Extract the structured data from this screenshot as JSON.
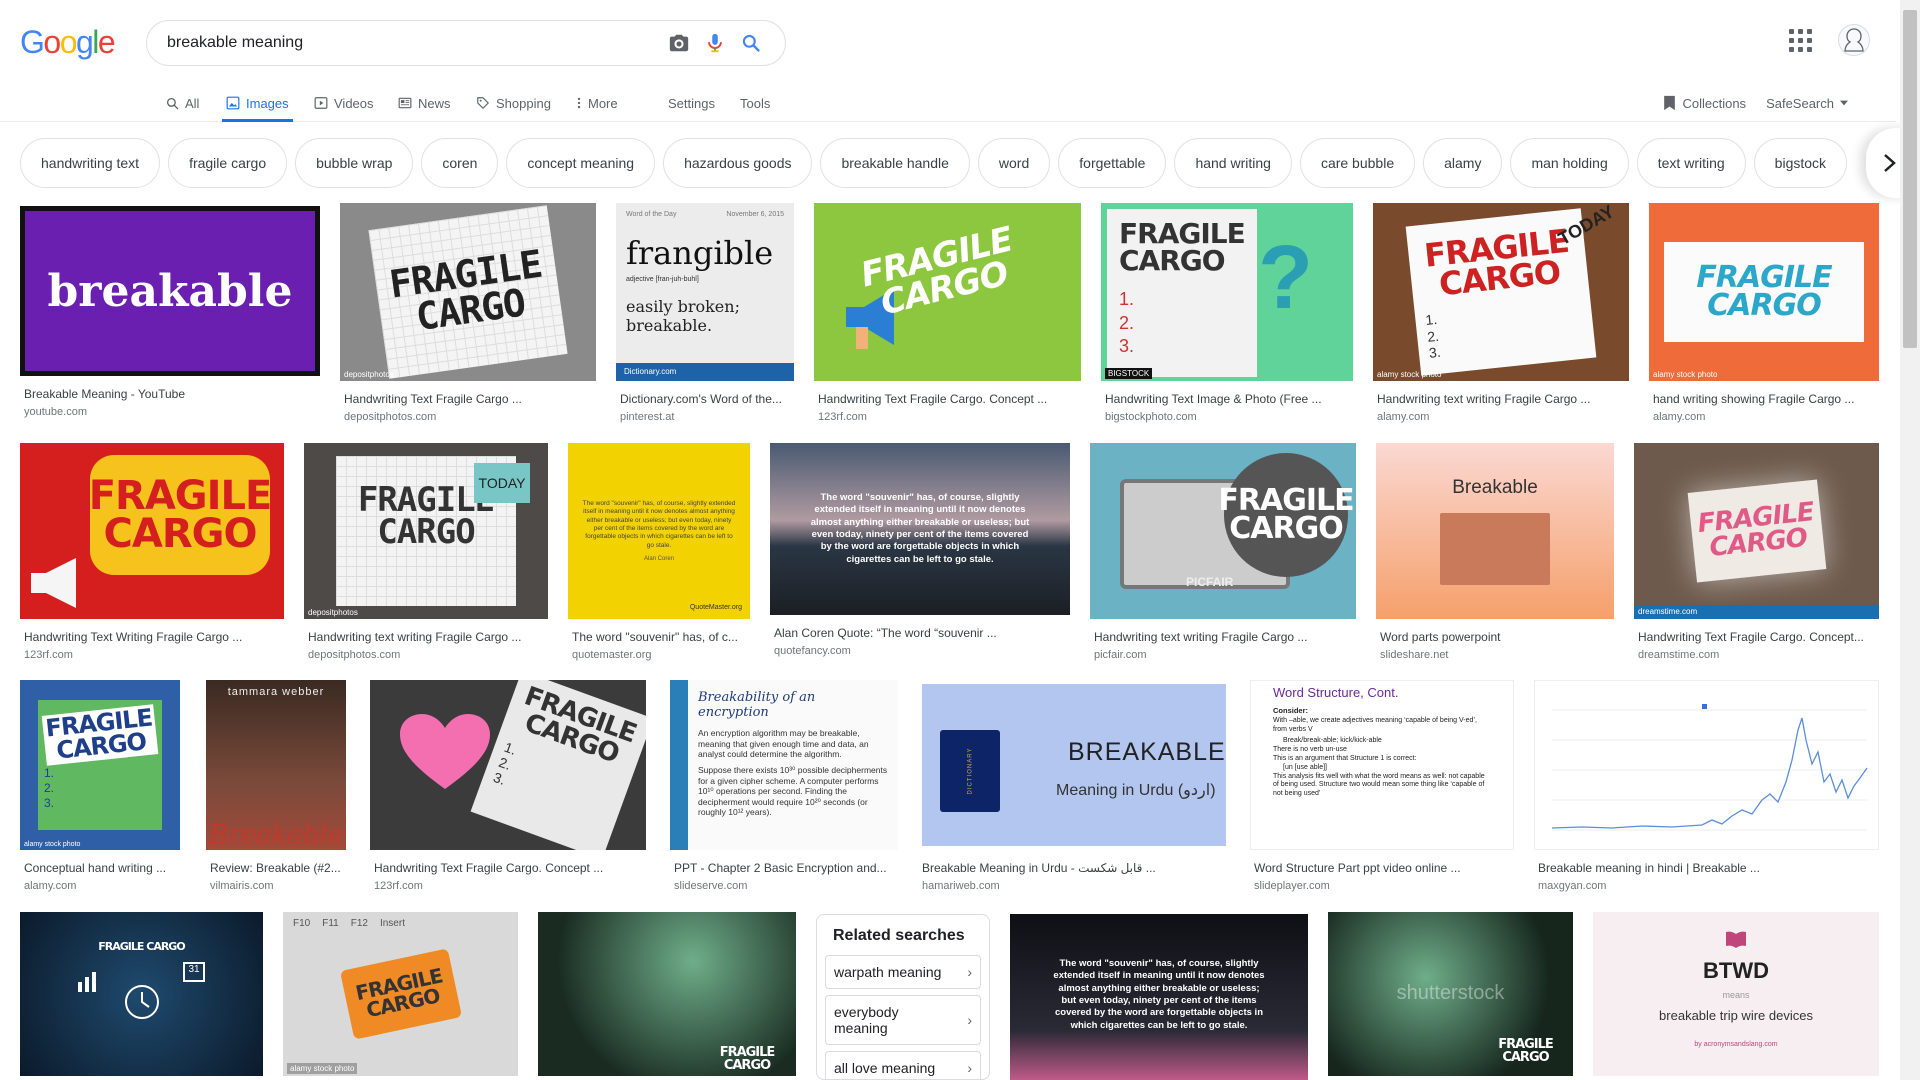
{
  "search": {
    "query": "breakable meaning"
  },
  "logo": {
    "letters": [
      "G",
      "o",
      "o",
      "g",
      "l",
      "e"
    ],
    "colors": [
      "#4285F4",
      "#EA4335",
      "#FBBC05",
      "#4285F4",
      "#34A853",
      "#EA4335"
    ]
  },
  "tabs": [
    {
      "label": "All",
      "icon": "search-icon",
      "active": false
    },
    {
      "label": "Images",
      "icon": "image-icon",
      "active": true
    },
    {
      "label": "Videos",
      "icon": "video-icon",
      "active": false
    },
    {
      "label": "News",
      "icon": "news-icon",
      "active": false
    },
    {
      "label": "Shopping",
      "icon": "tag-icon",
      "active": false
    },
    {
      "label": "More",
      "icon": "more-vert-icon",
      "active": false
    },
    {
      "label": "Settings",
      "active": false
    },
    {
      "label": "Tools",
      "active": false
    }
  ],
  "nav_right": {
    "collections": "Collections",
    "safesearch": "SafeSearch"
  },
  "chips": [
    "handwriting text",
    "fragile cargo",
    "bubble wrap",
    "coren",
    "concept meaning",
    "hazardous goods",
    "breakable handle",
    "word",
    "forgettable",
    "hand writing",
    "care bubble",
    "alamy",
    "man holding",
    "text writing",
    "bigstock"
  ],
  "results": [
    {
      "caption": "Breakable Meaning - YouTube",
      "source": "youtube.com",
      "art": "breakable"
    },
    {
      "caption": "Handwriting Text Fragile Cargo ...",
      "source": "depositphotos.com",
      "art": "FRAGILE CARGO"
    },
    {
      "caption": "Dictionary.com's Word of the...",
      "source": "pinterest.at",
      "art": "frangible"
    },
    {
      "caption": "Handwriting Text Fragile Cargo. Concept ...",
      "source": "123rf.com",
      "art": "FRAGILE CARGO"
    },
    {
      "caption": "Handwriting Text Image & Photo (Free ...",
      "source": "bigstockphoto.com",
      "art": "FRAGILE CARGO"
    },
    {
      "caption": "Handwriting text writing Fragile Cargo ...",
      "source": "alamy.com",
      "art": "FRAGILE CARGO"
    },
    {
      "caption": "hand writing showing Fragile Cargo ...",
      "source": "alamy.com",
      "art": "FRAGILE CARGO"
    },
    {
      "caption": "Handwriting Text Writing Fragile Cargo ...",
      "source": "123rf.com",
      "art": "FRAGILE CARGO"
    },
    {
      "caption": "Handwriting text writing Fragile Cargo ...",
      "source": "depositphotos.com",
      "art": "FRAGILE CARGO"
    },
    {
      "caption": "The word \"souvenir\" has, of c...",
      "source": "quotemaster.org",
      "art": ""
    },
    {
      "caption": "Alan Coren Quote: “The word “souvenir ...",
      "source": "quotefancy.com",
      "art": "The word \"souvenir\" has, of course, slightly extended itself in meaning until it now denotes almost anything either breakable or useless; but even today, ninety per cent of the items covered by the word are forgettable objects in which cigarettes can be left to go stale."
    },
    {
      "caption": "Handwriting text writing Fragile Cargo ...",
      "source": "picfair.com",
      "art": "FRAGILE CARGO"
    },
    {
      "caption": "Word parts powerpoint",
      "source": "slideshare.net",
      "art": "Breakable"
    },
    {
      "caption": "Handwriting Text Fragile Cargo. Concept...",
      "source": "dreamstime.com",
      "art": "FRAGILE CARGO"
    },
    {
      "caption": "Conceptual hand writing ...",
      "source": "alamy.com",
      "art": "FRAGILE CARGO"
    },
    {
      "caption": "Review: Breakable (#2...",
      "source": "vilmairis.com",
      "art": "tammara webber"
    },
    {
      "caption": "Handwriting Text Fragile Cargo. Concept ...",
      "source": "123rf.com",
      "art": "FRAGILE CARGO"
    },
    {
      "caption": "PPT - Chapter 2 Basic Encryption and...",
      "source": "slideserve.com",
      "art": "Breakability of an encryption"
    },
    {
      "caption": "Breakable Meaning in Urdu - قابل شکست ...",
      "source": "hamariweb.com",
      "art": "BREAKABLE"
    },
    {
      "caption": "Word Structure Part ppt video online ...",
      "source": "slideplayer.com",
      "art": "Word Structure, Cont."
    },
    {
      "caption": "Breakable meaning in hindi | Breakable ...",
      "source": "maxgyan.com",
      "art": ""
    }
  ],
  "bottom_row": [
    {
      "art": "FRAGILE CARGO"
    },
    {
      "art": "FRAGILE CARGO"
    },
    {
      "art": "FRAGILE CARGO"
    },
    {
      "art": "The word \"souvenir\" has, of course, slightly extended itself in meaning until it now denotes almost anything either breakable or useless; but even today, ninety per cent of the items covered by the word are forgettable objects in which cigarettes can be left to go stale."
    },
    {
      "art": "FRAGILE CARGO"
    },
    {
      "art": "BTWD"
    }
  ],
  "art_text": {
    "frangible_pos": "adjective [fran-juh-buhl]",
    "frangible_def": "easily broken; breakable.",
    "frangible_header": "Word of the Day",
    "frangible_date": "November 6, 2015",
    "dictionary_brand": "Dictionary.com",
    "today": "TODAY",
    "meaning_in_urdu": "Meaning in Urdu (اردو)",
    "dictionary_spine": "DICTIONARY",
    "breakable_cover": "Breakable",
    "encryption_lines": [
      "An encryption algorithm may be breakable, meaning that given enough time and data, an analyst could determine the algorithm.",
      "Suppose there exists 10³⁰ possible decipherments for a given cipher scheme. A computer performs 10¹⁰ operations per second. Finding the decipherment would require 10²⁰ seconds (or roughly 10¹² years)."
    ],
    "word_structure_lines": [
      "Consider:",
      "With –able, we create adjectives meaning ‘capable of being V-ed’, from verbs V",
      "Break/break-able; kick/kick-able",
      "There is no verb un-use",
      "This is an argument that Structure 1 is correct:",
      "[un [use able]]",
      "This analysis fits well with what the word means as well: not capable of being used. Structure two would mean some thing like ‘capable of not being used’"
    ],
    "btwd_means": "means",
    "btwd_full": "breakable trip wire devices",
    "btwd_footer": "by acronymsandslang.com",
    "quote_author": "Alan Coren",
    "quotemaster": "QuoteMaster.org",
    "picfair": "PICFAIR",
    "alamy_badge": "alamy stock photo",
    "depositphotos_badge": "depositphotos",
    "bigstock_badge": "BIGSTOCK",
    "dreamstime_badge": "dreamstime.com",
    "shutterstock": "shutterstock",
    "numbers": [
      "1.",
      "2.",
      "3."
    ],
    "keys": [
      "F10",
      "F11",
      "F12",
      "Insert"
    ],
    "calendar_day": "31"
  },
  "related": {
    "title": "Related searches",
    "items": [
      "warpath meaning",
      "everybody meaning",
      "all love meaning"
    ]
  },
  "colors": {
    "accent": "#1a73e8",
    "text": "#202124",
    "muted": "#70757a"
  }
}
